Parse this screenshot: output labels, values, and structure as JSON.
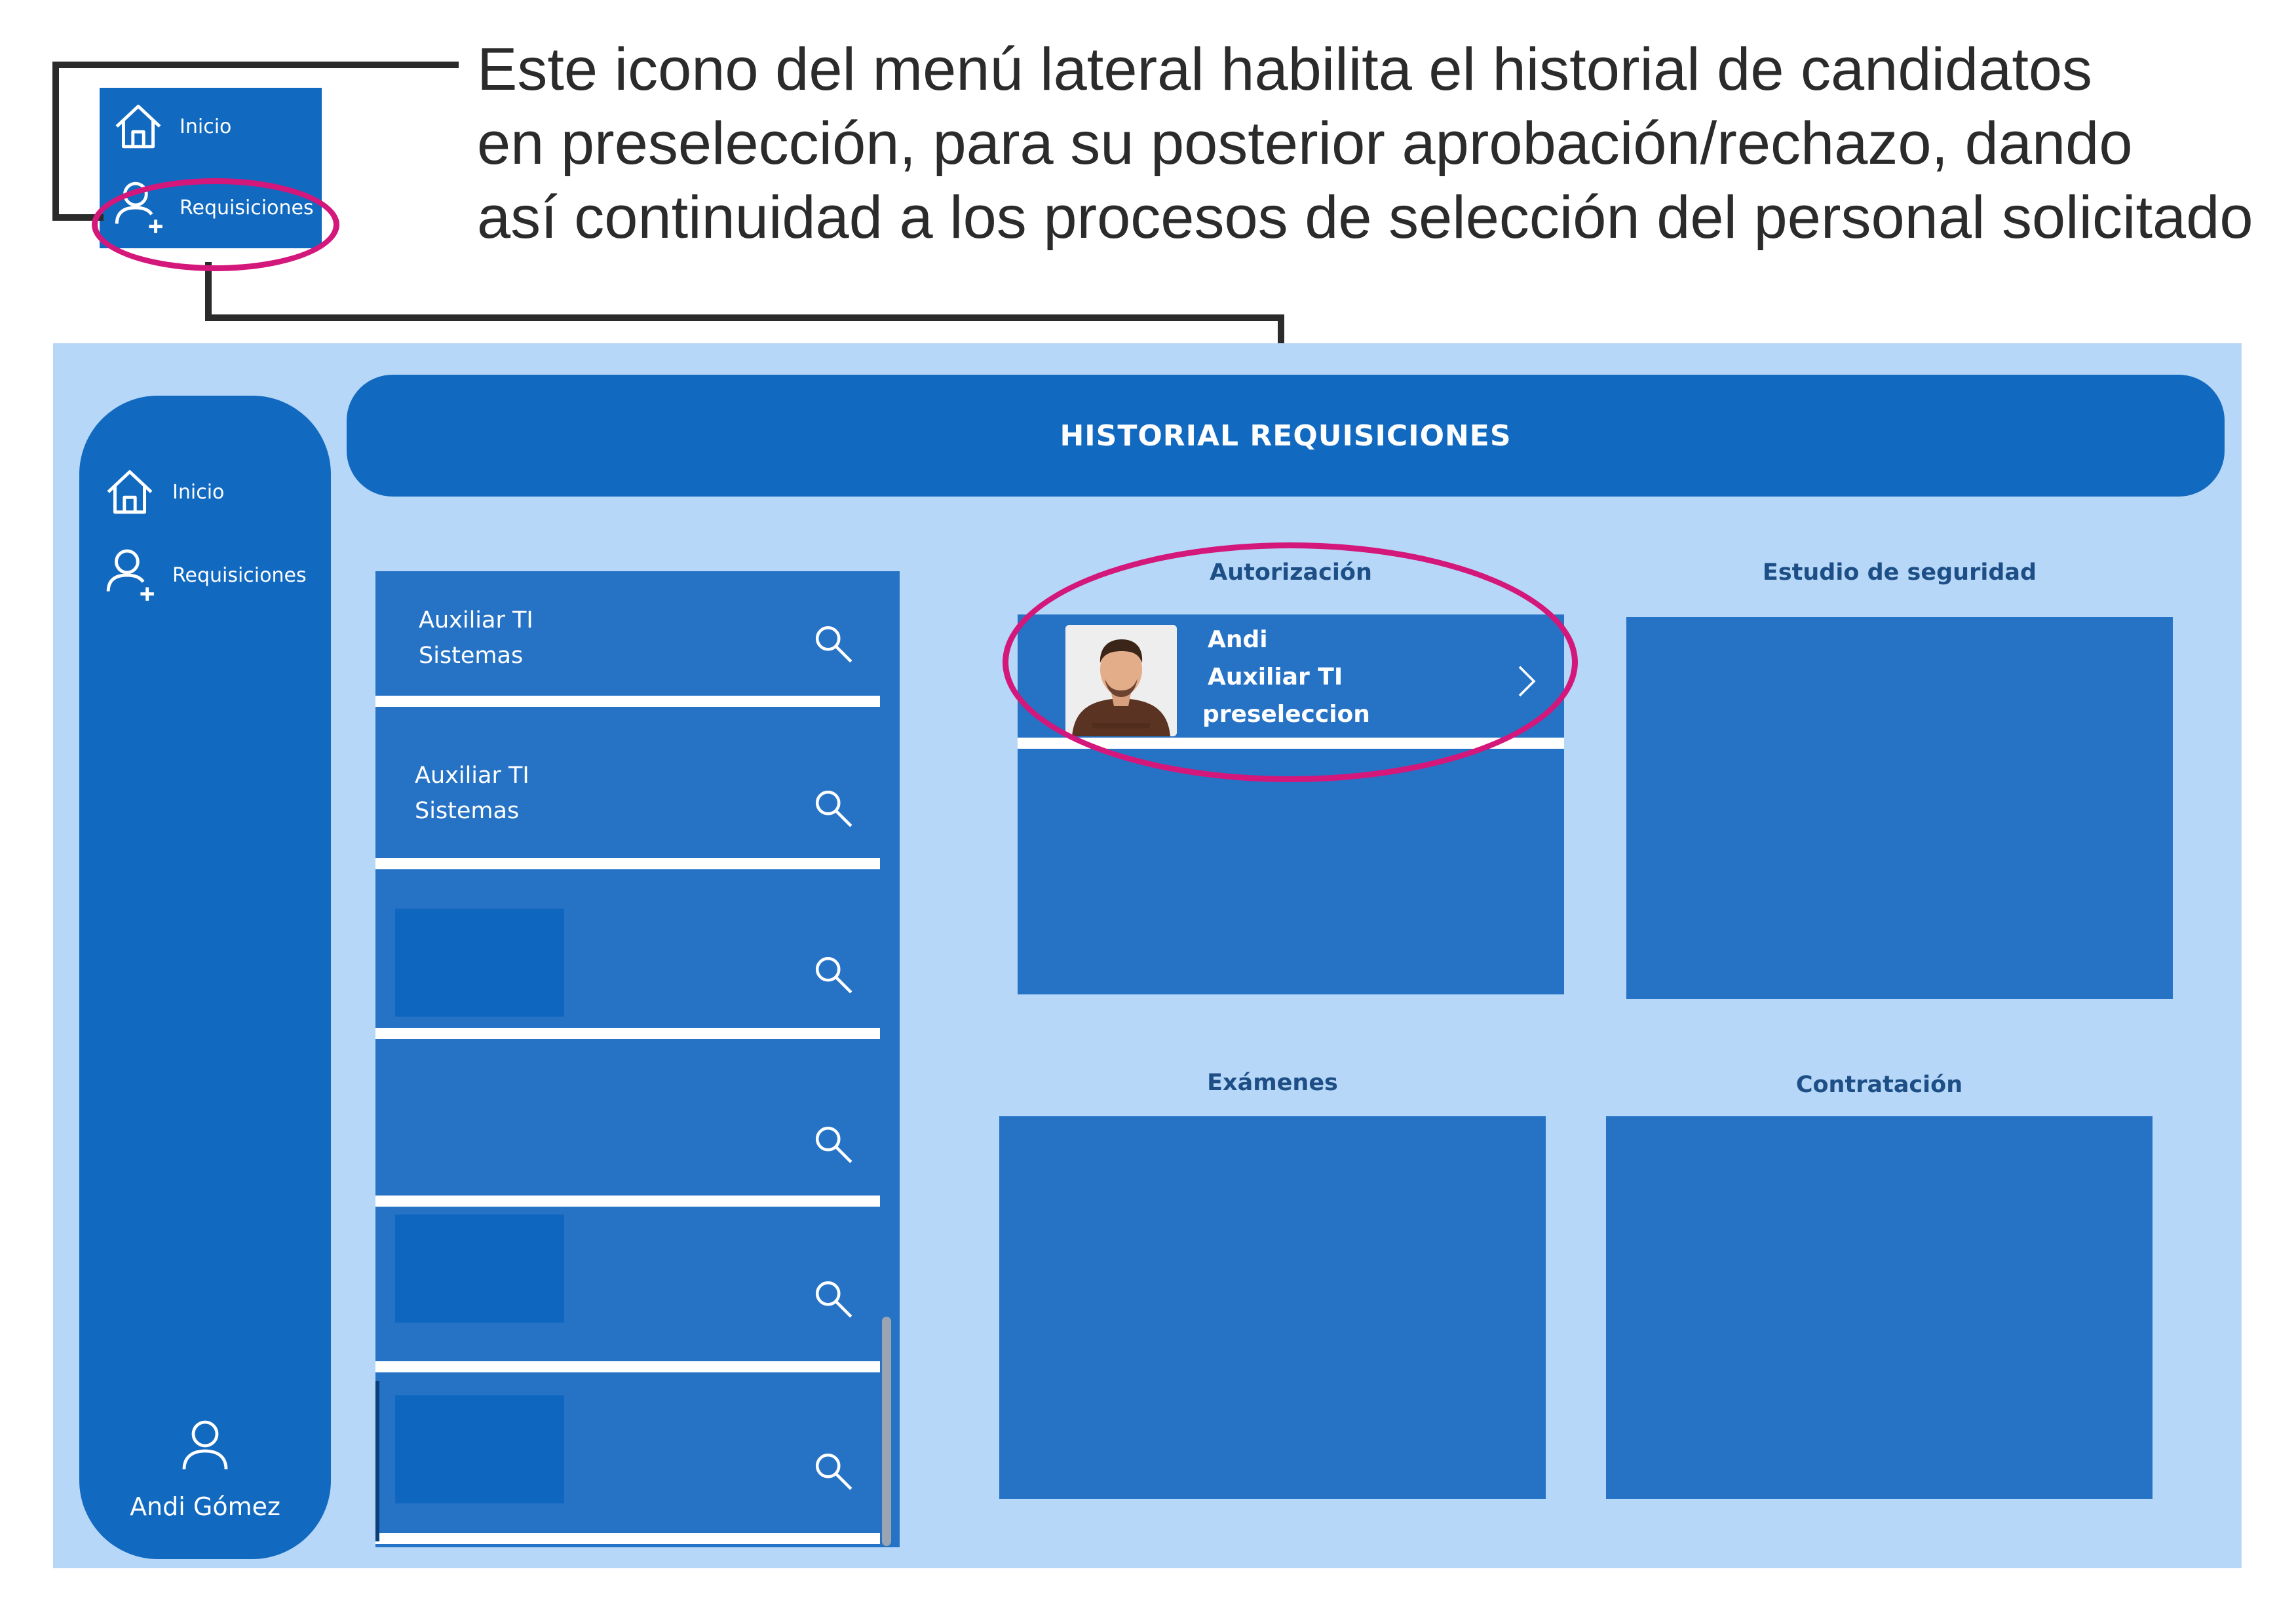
{
  "annotation": {
    "lines": [
      "Este icono del menú lateral habilita el historial de candidatos",
      "en preselección, para su posterior aprobación/rechazo, dando",
      "así continuidad a los procesos de selección del personal solicitado"
    ],
    "zoom_menu": {
      "home_label": "Inicio",
      "requisitions_label": "Requisiciones"
    },
    "highlight_color": "#d4177a"
  },
  "app": {
    "sidebar": {
      "items": [
        {
          "label": "Inicio",
          "icon": "home-icon"
        },
        {
          "label": "Requisiciones",
          "icon": "user-add-icon"
        }
      ],
      "user": {
        "name": "Andi Gómez",
        "icon": "user-icon"
      }
    },
    "header": {
      "title": "HISTORIAL REQUISICIONES"
    },
    "requisitions": [
      {
        "line1": "Auxiliar TI",
        "line2": "Sistemas"
      },
      {
        "line1": "Auxiliar TI",
        "line2": "Sistemas"
      },
      {
        "line1": "",
        "line2": ""
      },
      {
        "line1": "",
        "line2": ""
      },
      {
        "line1": "",
        "line2": ""
      },
      {
        "line1": "",
        "line2": ""
      }
    ],
    "sections": {
      "authorization": {
        "title": "Autorización",
        "candidate": {
          "name": "Andi",
          "position": "Auxiliar TI",
          "status": "preseleccion"
        }
      },
      "security_study": {
        "title": "Estudio de seguridad"
      },
      "exams": {
        "title": "Exámenes"
      },
      "hiring": {
        "title": "Contratación"
      }
    },
    "colors": {
      "frame": "#b6d7f8",
      "primary": "#1169c0",
      "panel": "#2673c6",
      "section_title": "#1d4f86"
    }
  }
}
